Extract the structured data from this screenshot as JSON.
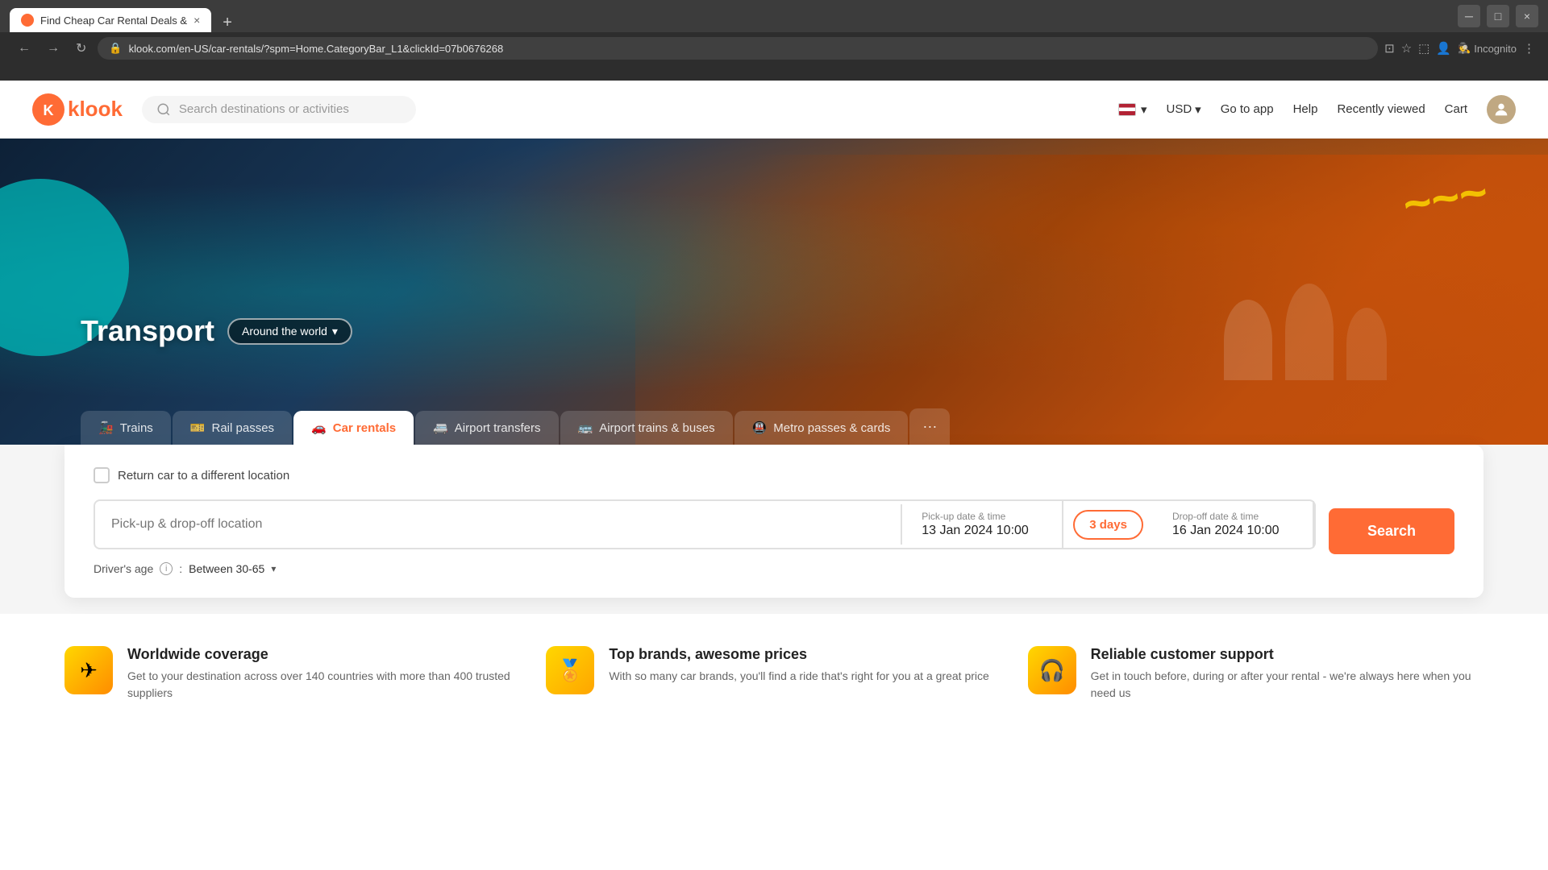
{
  "browser": {
    "tab_title": "Find Cheap Car Rental Deals &",
    "tab_icon": "klook-icon",
    "url": "klook.com/en-US/car-rentals/?spm=Home.CategoryBar_L1&clickId=07b0676268",
    "new_tab_label": "+",
    "close_label": "×",
    "nav": {
      "back": "←",
      "forward": "→",
      "refresh": "↻"
    },
    "address_bar_icon": "🔒",
    "incognito_label": "Incognito",
    "actions": {
      "cast": "⊡",
      "bookmark": "☆",
      "sidebar": "⬚",
      "profile": "👤",
      "menu": "⋮"
    }
  },
  "header": {
    "logo_text": "klook",
    "search_placeholder": "Search destinations or activities",
    "lang_btn": "🇺🇸",
    "currency": "USD",
    "currency_arrow": "▾",
    "go_to_app": "Go to app",
    "help": "Help",
    "recently_viewed": "Recently viewed",
    "cart": "Cart"
  },
  "hero": {
    "title": "Transport",
    "location_btn": "Around the world",
    "location_btn_arrow": "▾",
    "teal_circle": true,
    "yellow_squiggle": "~~~"
  },
  "tabs": [
    {
      "id": "trains",
      "label": "Trains",
      "icon": "🚂",
      "active": false
    },
    {
      "id": "rail-passes",
      "label": "Rail passes",
      "icon": "🎫",
      "active": false
    },
    {
      "id": "car-rentals",
      "label": "Car rentals",
      "icon": "🚗",
      "active": true
    },
    {
      "id": "airport-transfers",
      "label": "Airport transfers",
      "icon": "🚐",
      "active": false
    },
    {
      "id": "airport-trains",
      "label": "Airport trains & buses",
      "icon": "🚌",
      "active": false
    },
    {
      "id": "metro-passes",
      "label": "Metro passes & cards",
      "icon": "🚇",
      "active": false
    },
    {
      "id": "more",
      "label": "···",
      "icon": "",
      "active": false
    }
  ],
  "search_panel": {
    "checkbox_label": "Return car to a different location",
    "location_placeholder": "Pick-up & drop-off location",
    "pickup_date_label": "Pick-up date & time",
    "pickup_date_value": "13 Jan 2024 10:00",
    "days_badge": "3 days",
    "dropoff_date_label": "Drop-off date & time",
    "dropoff_date_value": "16 Jan 2024 10:00",
    "search_btn_label": "Search",
    "driver_age_label": "Driver's age",
    "driver_age_value": "Between 30-65",
    "driver_age_arrow": "▾"
  },
  "features": [
    {
      "id": "worldwide",
      "icon": "✈",
      "title": "Worldwide coverage",
      "desc": "Get to your destination across over 140 countries with more than 400 trusted suppliers"
    },
    {
      "id": "top-brands",
      "icon": "🏅",
      "title": "Top brands, awesome prices",
      "desc": "With so many car brands, you'll find a ride that's right for you at a great price"
    },
    {
      "id": "support",
      "icon": "🎧",
      "title": "Reliable customer support",
      "desc": "Get in touch before, during or after your rental - we're always here when you need us"
    }
  ]
}
